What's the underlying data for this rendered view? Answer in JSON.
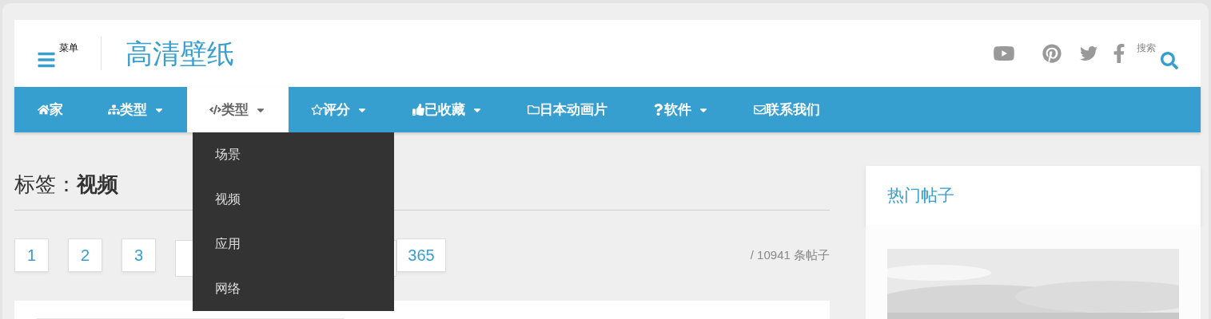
{
  "header": {
    "menu_label": "菜单",
    "logo": "高清壁纸",
    "search_label": "搜索"
  },
  "nav": [
    {
      "label": "家",
      "caret": false,
      "selected": false
    },
    {
      "label": "类型",
      "caret": true,
      "selected": false
    },
    {
      "label": "类型",
      "caret": true,
      "selected": true
    },
    {
      "label": "评分",
      "caret": true,
      "selected": false
    },
    {
      "label": "已收藏",
      "caret": true,
      "selected": false
    },
    {
      "label": "日本动画片",
      "caret": false,
      "selected": false
    },
    {
      "label": "软件",
      "caret": true,
      "selected": false
    },
    {
      "label": "联系我们",
      "caret": false,
      "selected": false
    }
  ],
  "dropdown": [
    "场景",
    "视频",
    "应用",
    "网络"
  ],
  "page_title": "标签：**视频**",
  "pagination": [
    "1",
    "2",
    "3",
    "365"
  ],
  "post_count": "/ 10941 条帖子",
  "sidebar": {
    "title": "热门帖子"
  }
}
